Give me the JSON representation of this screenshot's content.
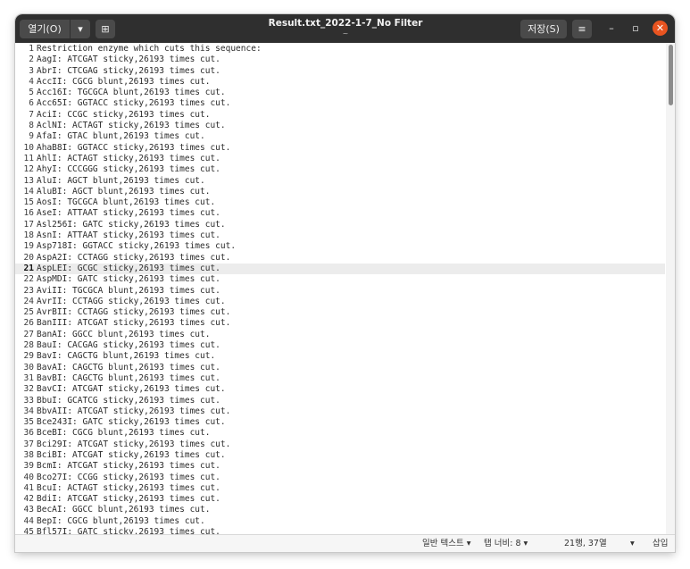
{
  "toolbar": {
    "open_label": "열기(O)",
    "open_arrow": "▾",
    "new_icon": "⊞",
    "title": "Result.txt_2022-1-7_No Filter",
    "subtitle": "~",
    "save_label": "저장(S)",
    "menu_icon": "≡",
    "minimize_icon": "–",
    "maximize_icon": "▫",
    "close_icon": "✕"
  },
  "editor": {
    "current_line": 21,
    "lines": [
      "Restriction enzyme which cuts this sequence:",
      "AagI: ATCGAT sticky,26193 times cut.",
      "AbrI: CTCGAG sticky,26193 times cut.",
      "AccII: CGCG blunt,26193 times cut.",
      "Acc16I: TGCGCA blunt,26193 times cut.",
      "Acc65I: GGTACC sticky,26193 times cut.",
      "AciI: CCGC sticky,26193 times cut.",
      "AclNI: ACTAGT sticky,26193 times cut.",
      "AfaI: GTAC blunt,26193 times cut.",
      "AhaB8I: GGTACC sticky,26193 times cut.",
      "AhlI: ACTAGT sticky,26193 times cut.",
      "AhyI: CCCGGG sticky,26193 times cut.",
      "AluI: AGCT blunt,26193 times cut.",
      "AluBI: AGCT blunt,26193 times cut.",
      "AosI: TGCGCA blunt,26193 times cut.",
      "AseI: ATTAAT sticky,26193 times cut.",
      "Asl256I: GATC sticky,26193 times cut.",
      "AsnI: ATTAAT sticky,26193 times cut.",
      "Asp718I: GGTACC sticky,26193 times cut.",
      "AspA2I: CCTAGG sticky,26193 times cut.",
      "AspLEI: GCGC sticky,26193 times cut.",
      "AspMDI: GATC sticky,26193 times cut.",
      "AviII: TGCGCA blunt,26193 times cut.",
      "AvrII: CCTAGG sticky,26193 times cut.",
      "AvrBII: CCTAGG sticky,26193 times cut.",
      "BanIII: ATCGAT sticky,26193 times cut.",
      "BanAI: GGCC blunt,26193 times cut.",
      "BauI: CACGAG sticky,26193 times cut.",
      "BavI: CAGCTG blunt,26193 times cut.",
      "BavAI: CAGCTG blunt,26193 times cut.",
      "BavBI: CAGCTG blunt,26193 times cut.",
      "BavCI: ATCGAT sticky,26193 times cut.",
      "BbuI: GCATCG sticky,26193 times cut.",
      "BbvAII: ATCGAT sticky,26193 times cut.",
      "Bce243I: GATC sticky,26193 times cut.",
      "BceBI: CGCG blunt,26193 times cut.",
      "Bci29I: ATCGAT sticky,26193 times cut.",
      "BciBI: ATCGAT sticky,26193 times cut.",
      "BcmI: ATCGAT sticky,26193 times cut.",
      "Bco27I: CCGG sticky,26193 times cut.",
      "BcuI: ACTAGT sticky,26193 times cut.",
      "BdiI: ATCGAT sticky,26193 times cut.",
      "BecAI: GGCC blunt,26193 times cut.",
      "BepI: CGCG blunt,26193 times cut.",
      "Bfl57I: GATC sticky,26193 times cut."
    ]
  },
  "statusbar": {
    "syntax": "일반 텍스트 ▾",
    "tab_width": "탭 너비: 8 ▾",
    "position": "21행, 37열",
    "mode_arrow": "▾",
    "insert_mode": "삽입"
  }
}
